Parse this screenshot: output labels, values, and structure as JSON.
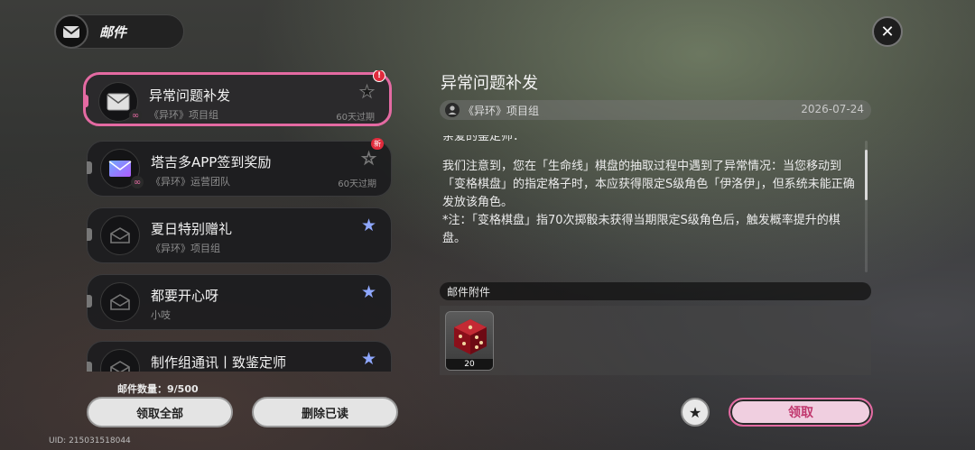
{
  "header": {
    "title": "邮件",
    "icon": "mail-icon"
  },
  "close": {
    "icon": "close-icon",
    "label": "✕"
  },
  "mails": [
    {
      "title": "异常问题补发",
      "sender": "《异环》项目组",
      "expire": "60天过期",
      "starred": false,
      "badge": "!",
      "badge_type": "alert",
      "selected": true,
      "has_link": true,
      "icon": "mail-closed-icon"
    },
    {
      "title": "塔吉多APP签到奖励",
      "sender": "《异环》运营团队",
      "expire": "60天过期",
      "starred": false,
      "badge": "新",
      "badge_type": "new",
      "selected": false,
      "has_link": true,
      "icon": "mail-app-icon"
    },
    {
      "title": "夏日特别赠礼",
      "sender": "《异环》项目组",
      "expire": "",
      "starred": true,
      "badge": "",
      "selected": false,
      "has_link": false,
      "icon": "mail-open-icon"
    },
    {
      "title": "都要开心呀",
      "sender": "小吱",
      "expire": "",
      "starred": true,
      "badge": "",
      "selected": false,
      "has_link": false,
      "icon": "mail-open-icon"
    },
    {
      "title": "制作组通讯丨致鉴定师",
      "sender": "",
      "expire": "",
      "starred": true,
      "badge": "",
      "selected": false,
      "has_link": false,
      "icon": "mail-open-icon"
    }
  ],
  "footer": {
    "count_label": "邮件数量：9/500",
    "claim_all": "领取全部",
    "delete_read": "删除已读",
    "uid": "UID: 215031518044"
  },
  "detail": {
    "title": "异常问题补发",
    "sender": "《异环》项目组",
    "date": "2026-07-24",
    "body": [
      "亲爱的鉴定师：",
      "",
      "我们注意到，您在「生命线」棋盘的抽取过程中遇到了异常情况：当您移动到「变格棋盘」的指定格子时，本应获得限定S级角色「伊洛伊」，但系统未能正确发放该角色。",
      "*注：「变格棋盘」指70次掷骰未获得当期限定S级角色后，触发概率提升的棋盘。"
    ],
    "attachments_label": "邮件附件",
    "attachments": [
      {
        "name": "dice-icon",
        "qty": "20"
      }
    ],
    "claim": "领取",
    "fav_icon": "star-icon"
  },
  "colors": {
    "accent": "#e46aa2",
    "star_blue": "#8fa8ff",
    "alert": "#e02b3c"
  }
}
